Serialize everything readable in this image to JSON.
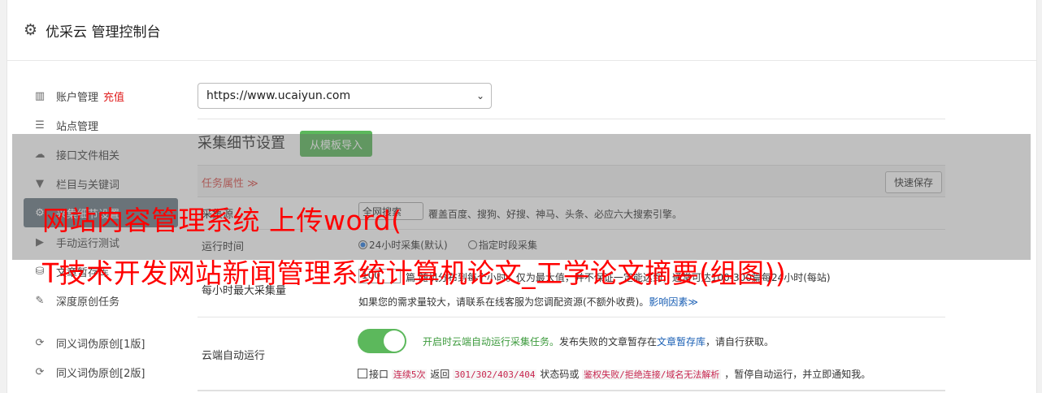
{
  "header": {
    "title": "优采云 管理控制台"
  },
  "sidebar": {
    "items": [
      {
        "label": "账户管理",
        "badge": "充值",
        "icon": "bar-chart-icon"
      },
      {
        "label": "站点管理",
        "icon": "server-icon"
      },
      {
        "label": "接口文件相关",
        "icon": "cloud-upload-icon"
      },
      {
        "label": "栏目与关键词",
        "icon": "filter-icon"
      },
      {
        "label": "采集细节设置",
        "icon": "gears-icon"
      },
      {
        "label": "手动运行测试",
        "icon": "play-circle-icon"
      },
      {
        "label": "文章暂存库",
        "icon": "database-icon"
      },
      {
        "label": "深度原创任务",
        "icon": "edit-icon"
      },
      {
        "label": "同义词伪原创[1版]",
        "icon": "refresh-icon"
      },
      {
        "label": "同义词伪原创[2版]",
        "icon": "refresh-icon"
      }
    ]
  },
  "site_select": {
    "value": "https://www.ucaiyun.com"
  },
  "section": {
    "title": "采集细节设置",
    "template_button": "从模板导入"
  },
  "taskbar": {
    "label": "任务属性 ≫",
    "quick_save": "快速保存"
  },
  "rows": {
    "engine": {
      "label": "采集源",
      "select": "全网搜索",
      "desc": "覆盖百度、搜狗、好搜、神马、头条、必应六大搜索引擎。"
    },
    "runtime": {
      "label": "运行时间",
      "opt1": "24小时采集(默认)",
      "opt2": "指定时段采集"
    },
    "max": {
      "label": "每小时最大采集量",
      "value": "100",
      "desc": "篇 随机分布到每个小时。仅为最大值，并不保证一定能达到，通常可达100-300篇每24小时(每站)",
      "note": "如果您的需求量较大，请联系在线客服为您调配资源(不额外收费)。",
      "note_link": "影响因素≫"
    },
    "cloud": {
      "label": "云端自动运行",
      "line1_green": "开启时云端自动运行采集任务。",
      "line1_rest": "发布失败的文章暂存在",
      "line1_link": "文章暂存库",
      "line1_end": "，请自行获取。",
      "l2_a": "接口",
      "l2_code1": "连续5次",
      "l2_b": "返回",
      "l2_code2": "301/302/403/404",
      "l2_c": "状态码或",
      "l2_code3": "鉴权失败/拒绝连接/域名无法解析",
      "l2_d": "，暂停自动运行，并立即通知我。"
    }
  },
  "overlay": {
    "line1": "网站内容管理系统 上传word(",
    "line2": "T技术开发网站新闻管理系统计算机论文_工学论文摘要(组图))"
  }
}
